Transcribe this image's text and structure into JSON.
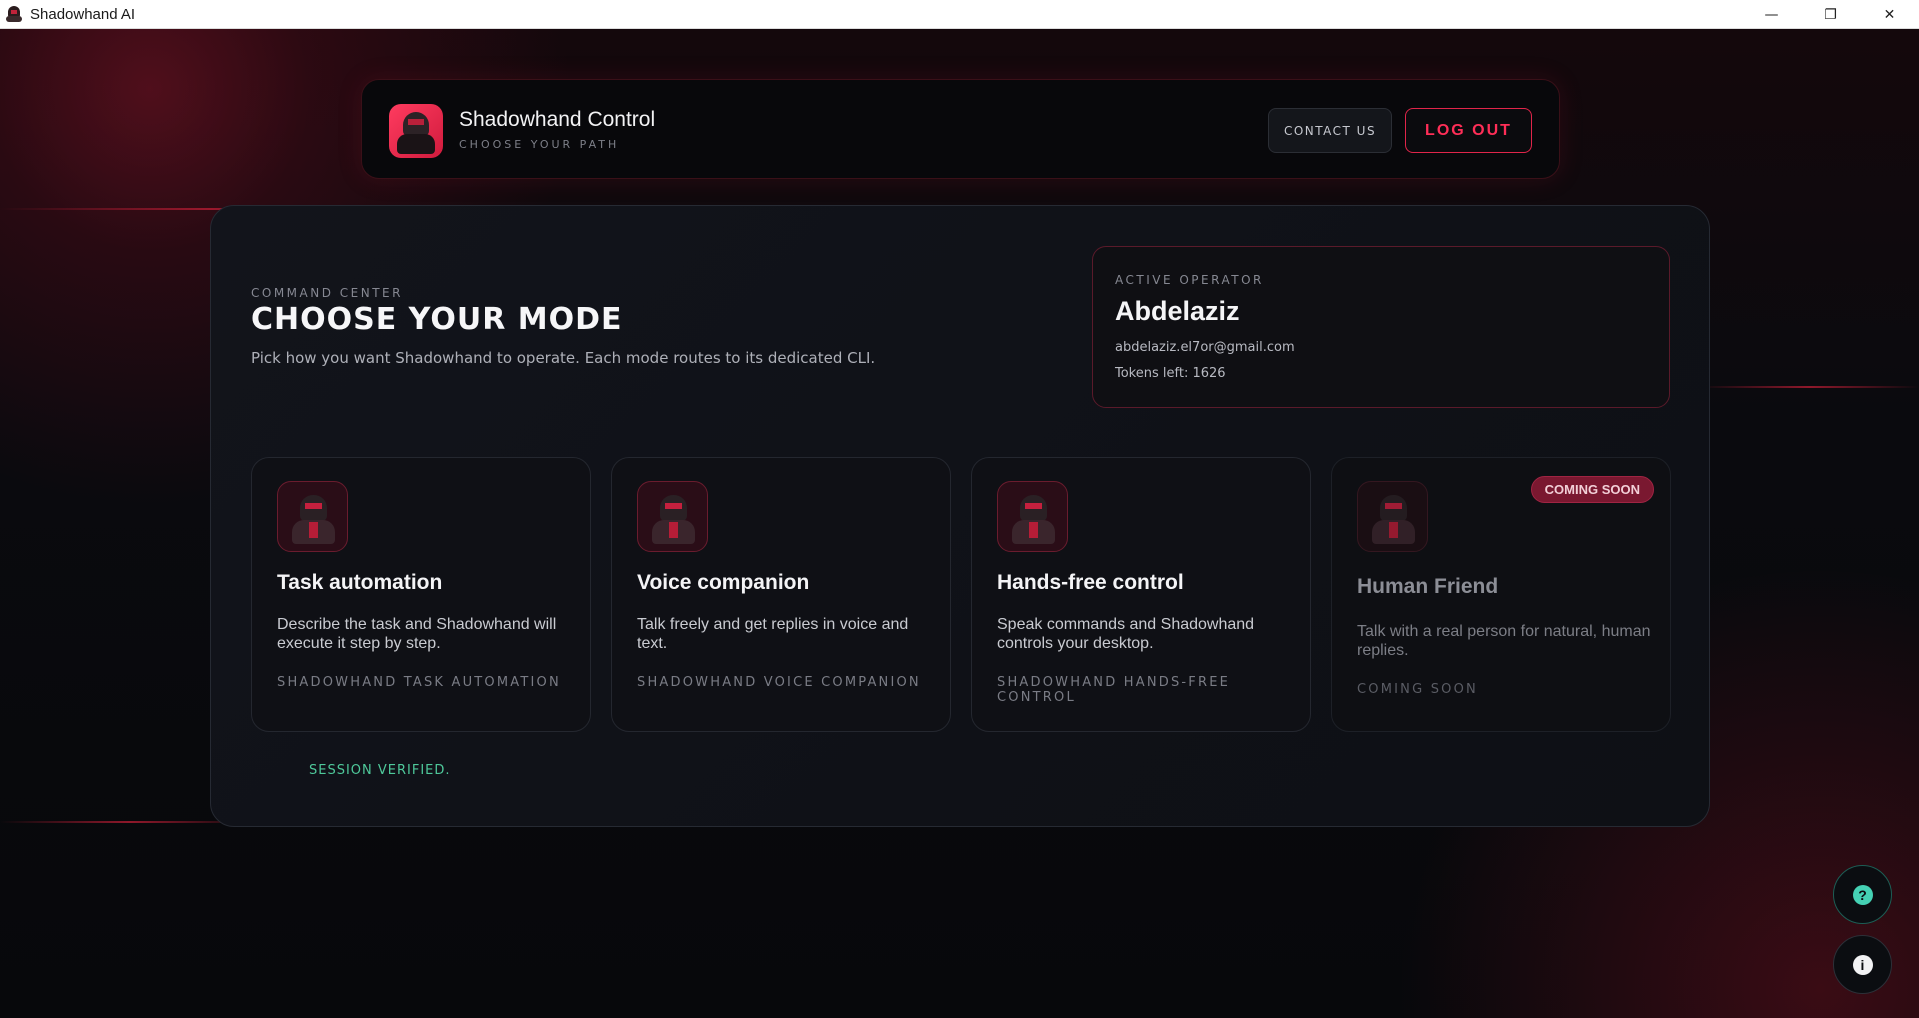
{
  "window": {
    "title": "Shadowhand AI",
    "controls": {
      "minimize": "—",
      "maximize": "❐",
      "close": "✕"
    }
  },
  "header": {
    "brand_title": "Shadowhand Control",
    "brand_subtitle": "CHOOSE YOUR PATH",
    "contact_label": "CONTACT US",
    "logout_label": "LOG OUT"
  },
  "intro": {
    "eyebrow": "COMMAND CENTER",
    "title": "CHOOSE YOUR MODE",
    "description": "Pick how you want Shadowhand to operate. Each mode routes to its dedicated CLI."
  },
  "operator": {
    "label": "ACTIVE OPERATOR",
    "name": "Abdelaziz",
    "email": "abdelaziz.el7or@gmail.com",
    "tokens": "Tokens left: 1626"
  },
  "modes": [
    {
      "icon": "task-ninja-icon",
      "title": "Task automation",
      "description": "Describe the task and Shadowhand will execute it step by step.",
      "tag": "SHADOWHAND TASK AUTOMATION"
    },
    {
      "icon": "voice-ninja-icon",
      "title": "Voice companion",
      "description": "Talk freely and get replies in voice and text.",
      "tag": "SHADOWHAND VOICE COMPANION"
    },
    {
      "icon": "handsfree-ninja-icon",
      "title": "Hands-free control",
      "description": "Speak commands and Shadowhand controls your desktop.",
      "tag": "SHADOWHAND HANDS-FREE CONTROL"
    },
    {
      "icon": "human-friend-icon",
      "title": "Human Friend",
      "description": "Talk with a real person for natural, human replies.",
      "tag": "COMING SOON",
      "badge": "COMING SOON"
    }
  ],
  "session_status": "SESSION VERIFIED.",
  "fabs": {
    "help_glyph": "?",
    "info_glyph": "i"
  },
  "colors": {
    "accent": "#ff2e57",
    "session_ok": "#4ec89a",
    "help_teal": "#45d1b4"
  }
}
